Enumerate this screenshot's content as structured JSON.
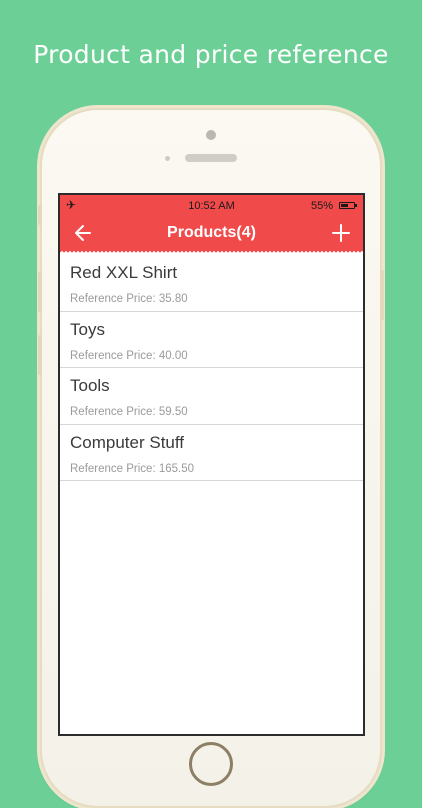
{
  "headline": "Product and price reference",
  "status_bar": {
    "time": "10:52 AM",
    "battery_percent": "55%",
    "battery_level": 0.55
  },
  "nav": {
    "title": "Products(4)",
    "back_icon": "arrow-left-icon",
    "add_icon": "plus-icon"
  },
  "products": [
    {
      "name": "Red XXL Shirt",
      "price": "Reference Price: 35.80"
    },
    {
      "name": "Toys",
      "price": "Reference Price: 40.00"
    },
    {
      "name": "Tools",
      "price": "Reference Price: 59.50"
    },
    {
      "name": "Computer Stuff",
      "price": "Reference Price: 165.50"
    }
  ],
  "colors": {
    "background": "#6cd096",
    "accent": "#f14a4b",
    "list_text": "#3a3a3a",
    "price_text": "#9a9a9a"
  }
}
